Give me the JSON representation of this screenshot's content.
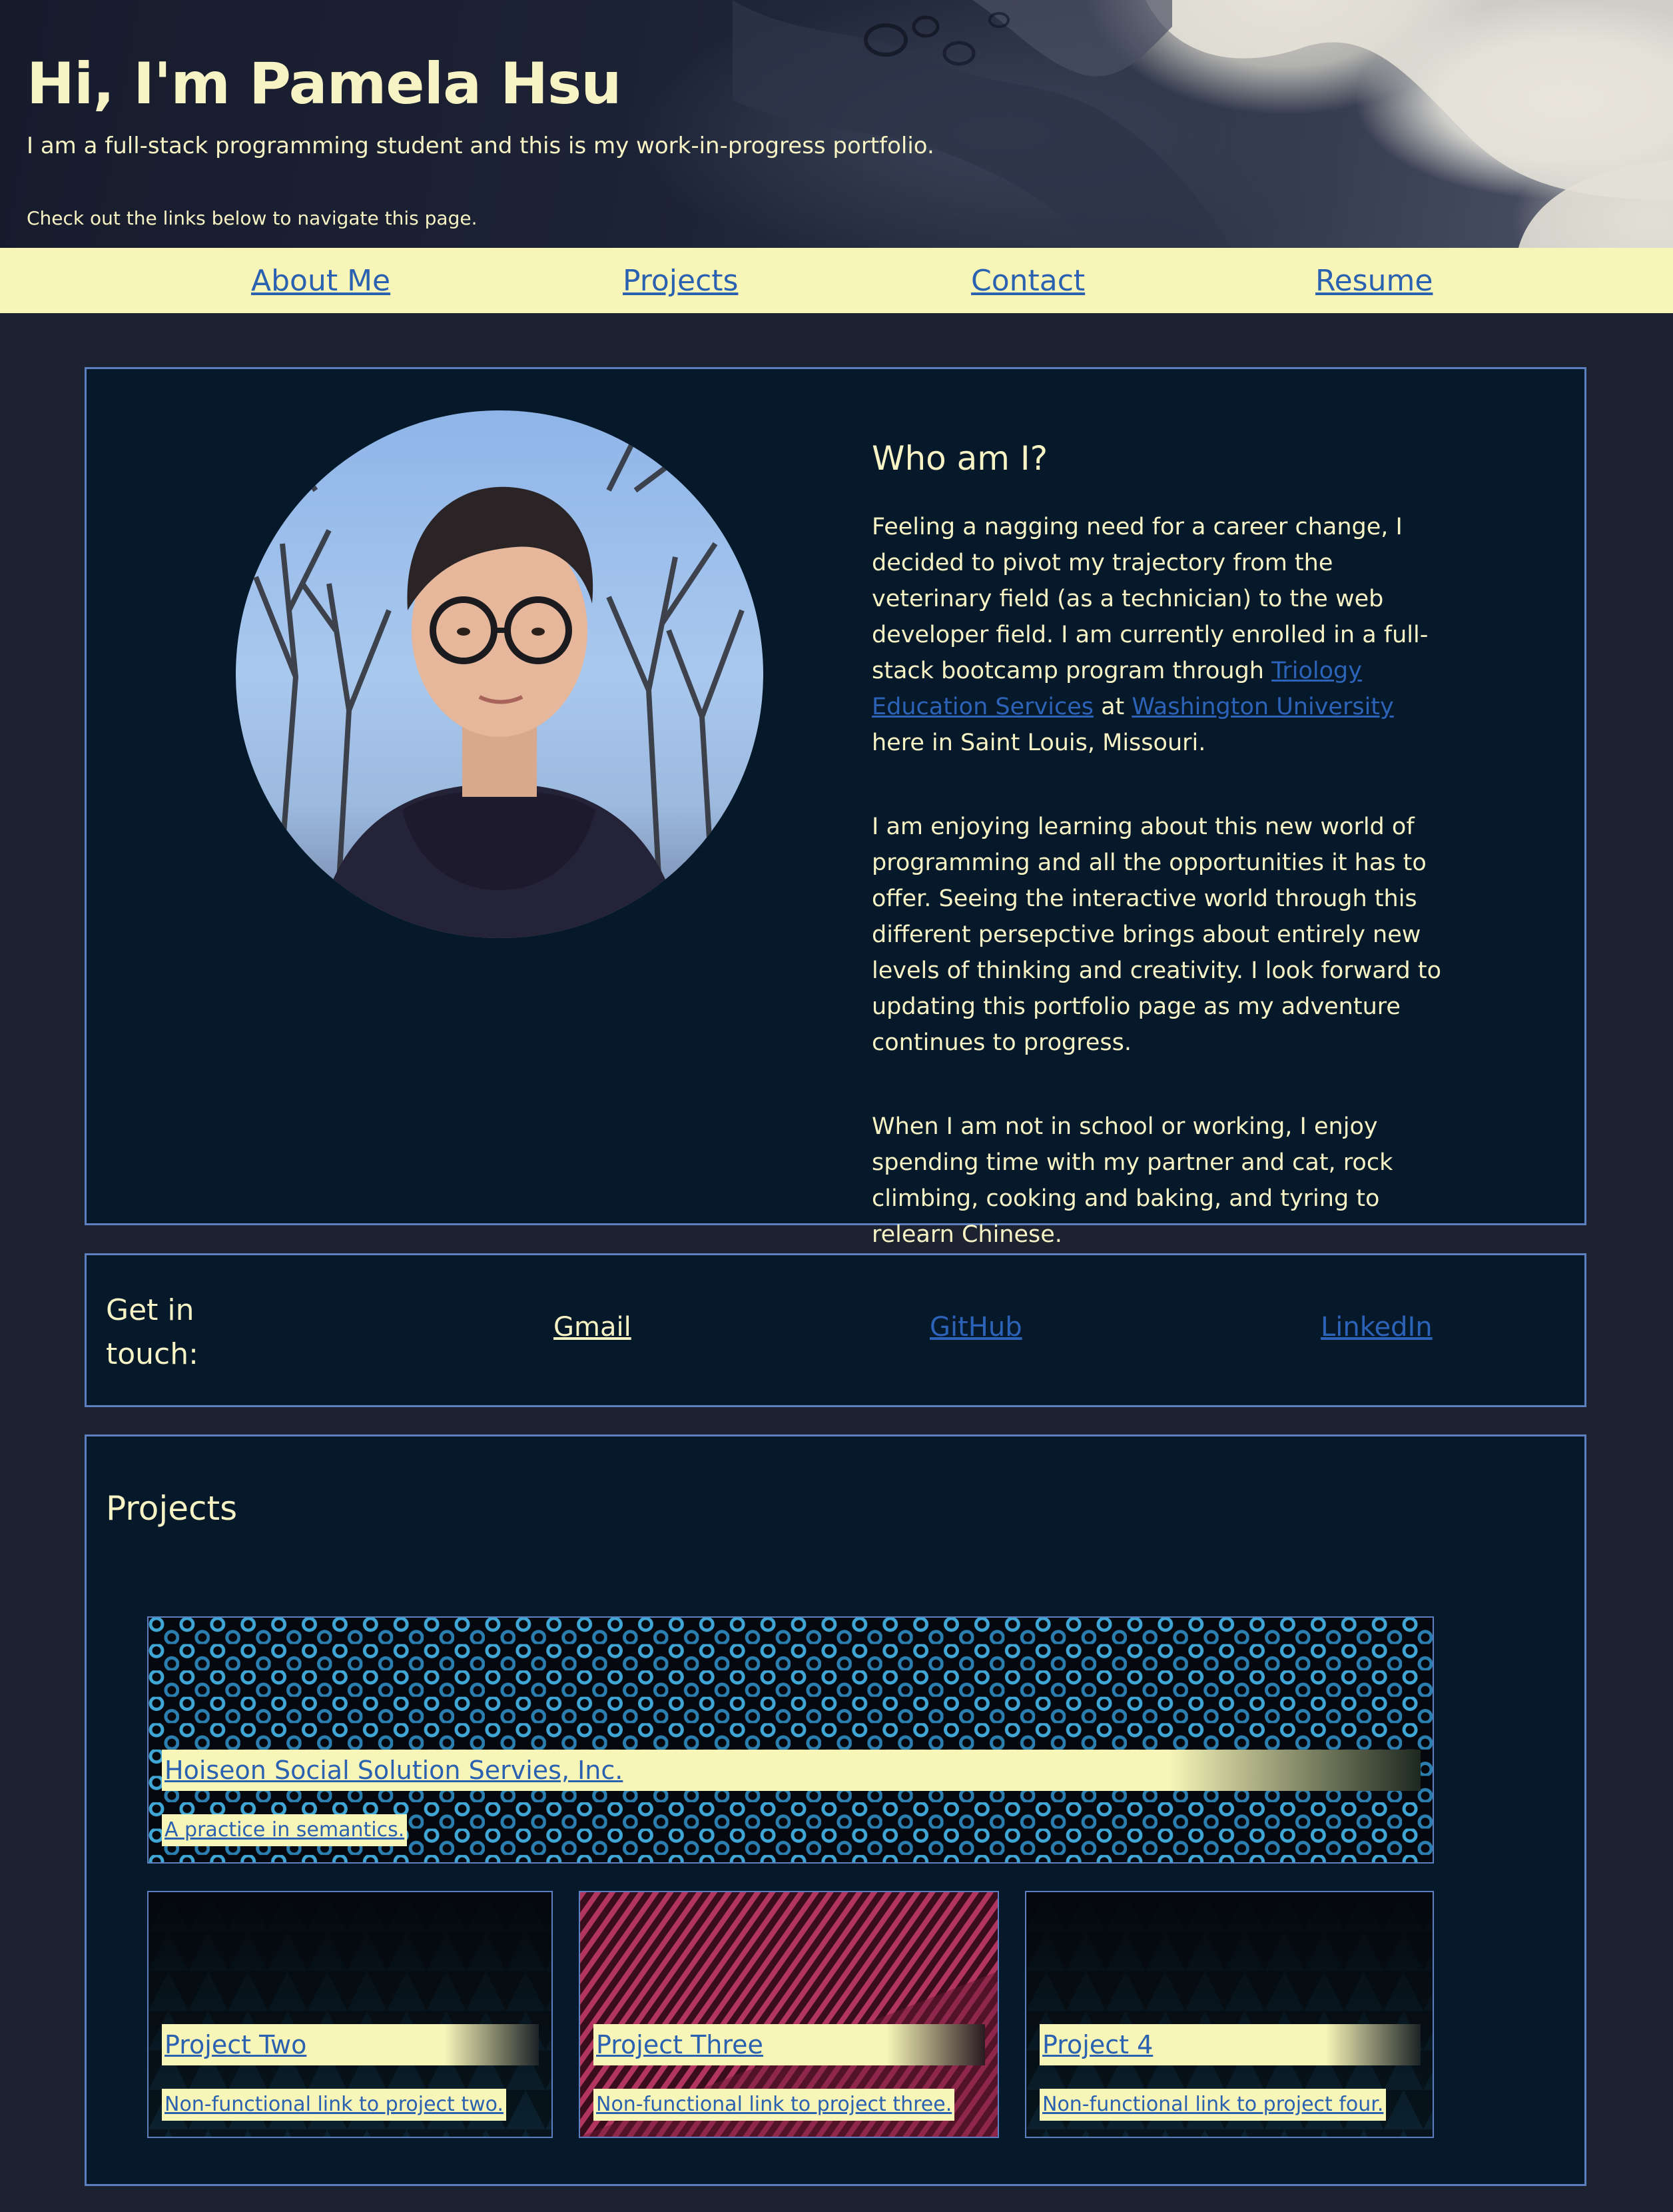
{
  "header": {
    "title": "Hi, I'm Pamela Hsu",
    "subtitle": "I am a full-stack programming student and this is my work-in-progress portfolio.",
    "note": "Check out the links below to navigate this page."
  },
  "nav": {
    "items": [
      {
        "label": "About Me"
      },
      {
        "label": "Projects"
      },
      {
        "label": "Contact"
      },
      {
        "label": "Resume"
      }
    ]
  },
  "about": {
    "heading": "Who am I?",
    "p1_before": "Feeling a nagging need for a career change, I decided to pivot my trajectory from the veterinary field (as a technician) to the web developer field. I am currently enrolled in a full-stack bootcamp program through ",
    "p1_link1": "Triology Education Services",
    "p1_mid": " at ",
    "p1_link2": "Washington University",
    "p1_after": " here in Saint Louis, Missouri.",
    "p2": "I am enjoying learning about this new world of programming and all the opportunities it has to offer. Seeing the interactive world through this different persepctive brings about entirely new levels of thinking and creativity. I look forward to updating this portfolio page as my adventure continues to progress.",
    "p3": "When I am not in school or working, I enjoy spending time with my partner and cat, rock climbing, cooking and baking, and tyring to relearn Chinese."
  },
  "contact": {
    "heading": "Get in touch:",
    "links": [
      {
        "label": "Gmail"
      },
      {
        "label": "GitHub"
      },
      {
        "label": "LinkedIn"
      }
    ]
  },
  "projects": {
    "heading": "Projects",
    "cards": [
      {
        "title": "Hoiseon Social Solution Servies, Inc.",
        "desc": "A practice in semantics."
      },
      {
        "title": "Project Two",
        "desc": "Non-functional link to project two."
      },
      {
        "title": "Project Three",
        "desc": "Non-functional link to project three."
      },
      {
        "title": "Project 4",
        "desc": "Non-functional link to project four."
      }
    ]
  },
  "colors": {
    "page_bg": "#1d2231",
    "panel_bg": "#06192a",
    "panel_border": "#5c7fbf",
    "accent_yellow": "#f7f5b8",
    "text_cream": "#f7f3c4",
    "link_blue": "#2c63b8"
  }
}
